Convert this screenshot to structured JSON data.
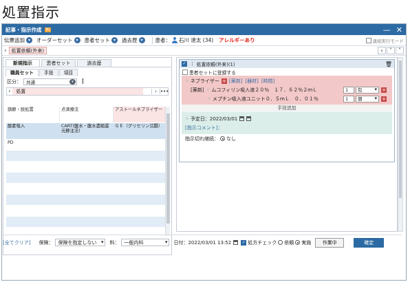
{
  "page_title": "処置指示",
  "window": {
    "title": "記事・指示作成",
    "badge": "Ri",
    "minimize": "—",
    "close": "✕"
  },
  "toolbar": {
    "items": [
      "伝票追加",
      "オーダーセット",
      "患者セット",
      "過去歴"
    ],
    "patient_label": "患者：",
    "patient_name": "石川 達太 (34)",
    "allergy": "アレルギーあり",
    "continuous_label": "連続実行モード"
  },
  "tab": {
    "label": "処置依頼(外来)"
  },
  "left": {
    "tabs": [
      "新規指示",
      "患者セット",
      "過去歴"
    ],
    "subtabs": [
      "職員セット",
      "手技",
      "項目"
    ],
    "filter_label": "区分：",
    "filter_value": "共通",
    "crumb": "処置",
    "columns": [
      "鎮静・脱処置",
      "点滴療法",
      "アストールネブライザー"
    ],
    "rows": [
      [
        "酸素吸入",
        "CART(腹水・腹水濃縮還元静注法)",
        "ＧＥ（グリセリン浣腸）"
      ],
      [
        "PD",
        "",
        ""
      ]
    ]
  },
  "right": {
    "card_title": "処置依頼(外来)(1)",
    "register_label": "患者セットに登録する",
    "procedure": "ネブライザー",
    "links": [
      "[薬剤]",
      "[器材]",
      "[時間]"
    ],
    "drug_tag": "[薬剤]",
    "drugs": [
      {
        "name": "ムコフィリン吸入液２０％　１７．６２％２ｍＬ",
        "qty": "1",
        "unit": "包"
      },
      {
        "name": "メプチン吸入液ユニット０．５ｍＬ　０．０１％",
        "qty": "1",
        "unit": "個"
      }
    ],
    "add_proc": "手技追加",
    "schedule_label": "予定日：",
    "schedule_date": "2022/03/01",
    "comment_label": "[指示コメント]：",
    "cutoff_label": "指示切れ継続：",
    "cutoff_value": "なし"
  },
  "footer": {
    "clear": "[全てクリア]",
    "insurance_label": "保険：",
    "insurance_value": "保険を指定しない",
    "fee_label": "料：",
    "fee_value": "一般内科",
    "date_label": "日付：",
    "date_value": "2022/03/01 13:52",
    "check_label": "処方チェック",
    "radio1": "依頼",
    "radio2": "実施",
    "work_btn": "作業中",
    "ok_btn": "確定"
  }
}
